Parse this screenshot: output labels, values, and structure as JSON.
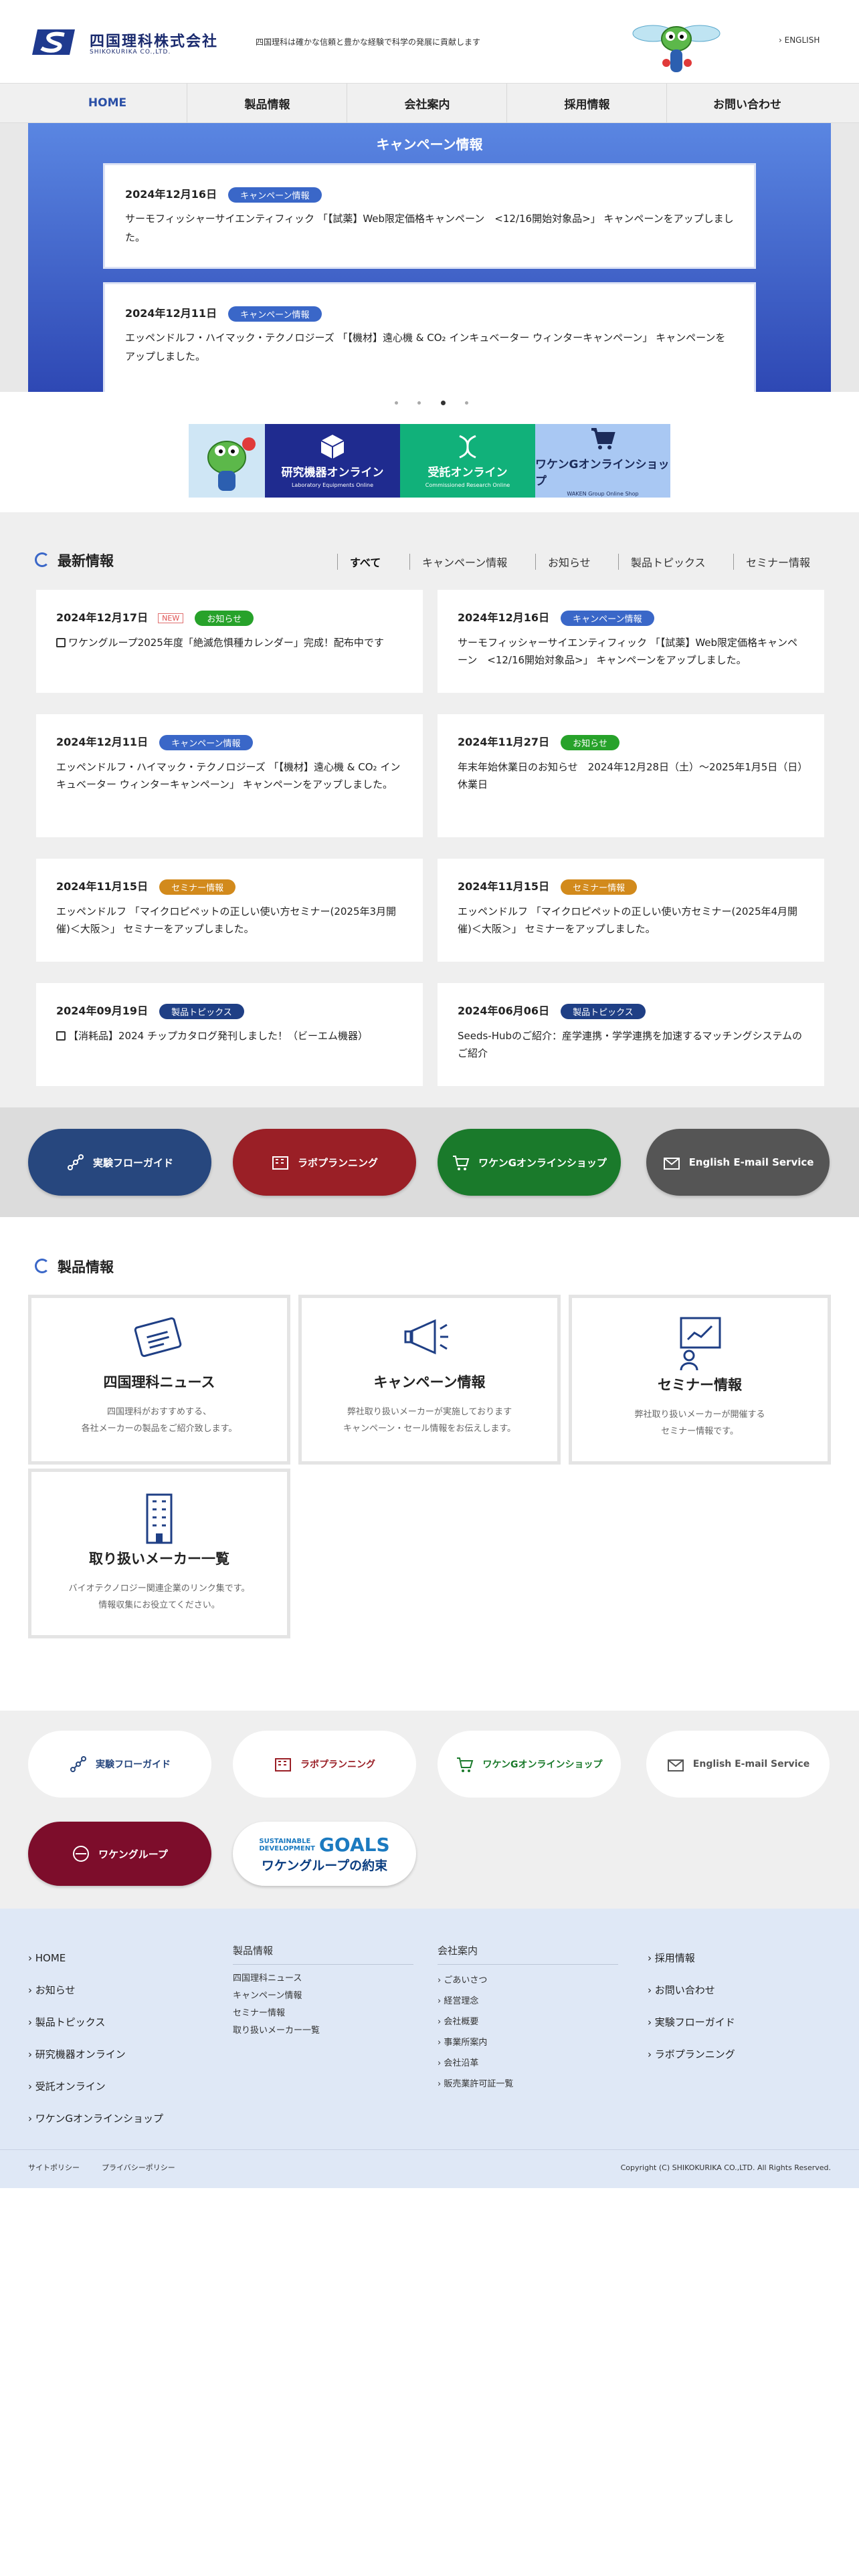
{
  "header": {
    "logo_jp": "四国理科株式会社",
    "logo_en": "SHIKOKURIKA CO.,LTD.",
    "tagline": "四国理科は確かな信頼と豊かな経験で科学の発展に貢献します",
    "lang": "ENGLISH"
  },
  "nav": [
    "HOME",
    "製品情報",
    "会社案内",
    "採用情報",
    "お問い合わせ"
  ],
  "campaign": {
    "title": "キャンペーン情報",
    "items": [
      {
        "date": "2024年12月16日",
        "badge": "キャンペーン情報",
        "text": "サーモフィッシャーサイエンティフィック 「【試薬】Web限定価格キャンペーン　<12/16開始対象品>」 キャンペーンをアップしました。"
      },
      {
        "date": "2024年12月11日",
        "badge": "キャンペーン情報",
        "text": "エッペンドルフ・ハイマック・テクノロジーズ 「【機材】遠心機 & CO₂ インキュベーター ウィンターキャンペーン」 キャンペーンをアップしました。"
      }
    ]
  },
  "shops": [
    {
      "title": "研究機器オンライン",
      "sub": "Laboratory Equipments Online",
      "color": "#1f2b8f"
    },
    {
      "title": "受託オンライン",
      "sub": "Commissioned Research Online",
      "color": "#11b17a"
    },
    {
      "title": "ワケンGオンラインショップ",
      "sub": "WAKEN Group Online Shop",
      "color": "#a9c8f3"
    }
  ],
  "news": {
    "title": "最新情報",
    "filters": [
      "すべて",
      "キャンペーン情報",
      "お知らせ",
      "製品トピックス",
      "セミナー情報"
    ],
    "new_label": "NEW",
    "items": [
      {
        "date": "2024年12月17日",
        "badge": "お知らせ",
        "text": "ワケングループ2025年度「絶滅危惧種カレンダー」完成！配布中です"
      },
      {
        "date": "2024年12月16日",
        "badge": "キャンペーン情報",
        "text": "サーモフィッシャーサイエンティフィック 「【試薬】Web限定価格キャンペーン　<12/16開始対象品>」 キャンペーンをアップしました。"
      },
      {
        "date": "2024年12月11日",
        "badge": "キャンペーン情報",
        "text": "エッペンドルフ・ハイマック・テクノロジーズ 「【機材】遠心機 & CO₂ インキュベーター ウィンターキャンペーン」 キャンペーンをアップしました。"
      },
      {
        "date": "2024年11月27日",
        "badge": "お知らせ",
        "text": "年末年始休業日のお知らせ　2024年12月28日（土）〜2025年1月5日（日）休業日"
      },
      {
        "date": "2024年11月15日",
        "badge": "セミナー情報",
        "text": "エッペンドルフ 「マイクロピペットの正しい使い方セミナー(2025年3月開催)＜大阪＞」 セミナーをアップしました。"
      },
      {
        "date": "2024年11月15日",
        "badge": "セミナー情報",
        "text": "エッペンドルフ 「マイクロピペットの正しい使い方セミナー(2025年4月開催)＜大阪＞」 セミナーをアップしました。"
      },
      {
        "date": "2024年09月19日",
        "badge": "製品トピックス",
        "text": "【消耗品】2024 チップカタログ発刊しました！（ビーエム機器）"
      },
      {
        "date": "2024年06月06日",
        "badge": "製品トピックス",
        "text": "Seeds-Hubのご紹介：産学連携・学学連携を加速するマッチングシステムのご紹介"
      }
    ]
  },
  "pills": [
    {
      "label": "実験フローガイド",
      "color": "#27477e"
    },
    {
      "label": "ラボプランニング",
      "color": "#9a1f26"
    },
    {
      "label": "ワケンGオンラインショップ",
      "color": "#1a7a2b"
    },
    {
      "label": "English E-mail Service",
      "color": "#555555"
    }
  ],
  "products": {
    "title": "製品情報",
    "cards": [
      {
        "title": "四国理科ニュース",
        "desc1": "四国理科がおすすめする、",
        "desc2": "各社メーカーの製品をご紹介致します。"
      },
      {
        "title": "キャンペーン情報",
        "desc1": "弊社取り扱いメーカーが実施しております",
        "desc2": "キャンペーン・セール情報をお伝えします。"
      },
      {
        "title": "セミナー情報",
        "desc1": "弊社取り扱いメーカーが開催する",
        "desc2": "セミナー情報です。"
      },
      {
        "title": "取り扱いメーカー一覧",
        "desc1": "バイオテクノロジー関連企業のリンク集です。",
        "desc2": "情報収集にお役立てください。"
      }
    ]
  },
  "pills2": [
    {
      "label": "実験フローガイド",
      "color": "#27477e"
    },
    {
      "label": "ラボプランニング",
      "color": "#9a1f26"
    },
    {
      "label": "ワケンGオンラインショップ",
      "color": "#1a7a2b"
    },
    {
      "label": "English E-mail Service",
      "color": "#555555"
    }
  ],
  "group": {
    "label": "ワケングループ",
    "sdg1": "SUSTAINABLE",
    "sdg2": "DEVELOPMENT",
    "goals": "GOALS",
    "promise": "ワケングループの約束"
  },
  "footer": {
    "col1": [
      "HOME",
      "お知らせ",
      "製品トピックス",
      "研究機器オンライン",
      "受託オンライン",
      "ワケンGオンラインショップ"
    ],
    "col2_head": "製品情報",
    "col2": [
      "四国理科ニュース",
      "キャンペーン情報",
      "セミナー情報",
      "取り扱いメーカー一覧"
    ],
    "col3_head": "会社案内",
    "col3": [
      "ごあいさつ",
      "経営理念",
      "会社概要",
      "事業所案内",
      "会社沿革",
      "販売業許可証一覧"
    ],
    "col4": [
      "採用情報",
      "お問い合わせ",
      "実験フローガイド",
      "ラボプランニング"
    ],
    "sitepolicy": "サイトポリシー",
    "privacy": "プライバシーポリシー",
    "copyright": "Copyright (C) SHIKOKURIKA CO.,LTD. All Rights Reserved."
  }
}
